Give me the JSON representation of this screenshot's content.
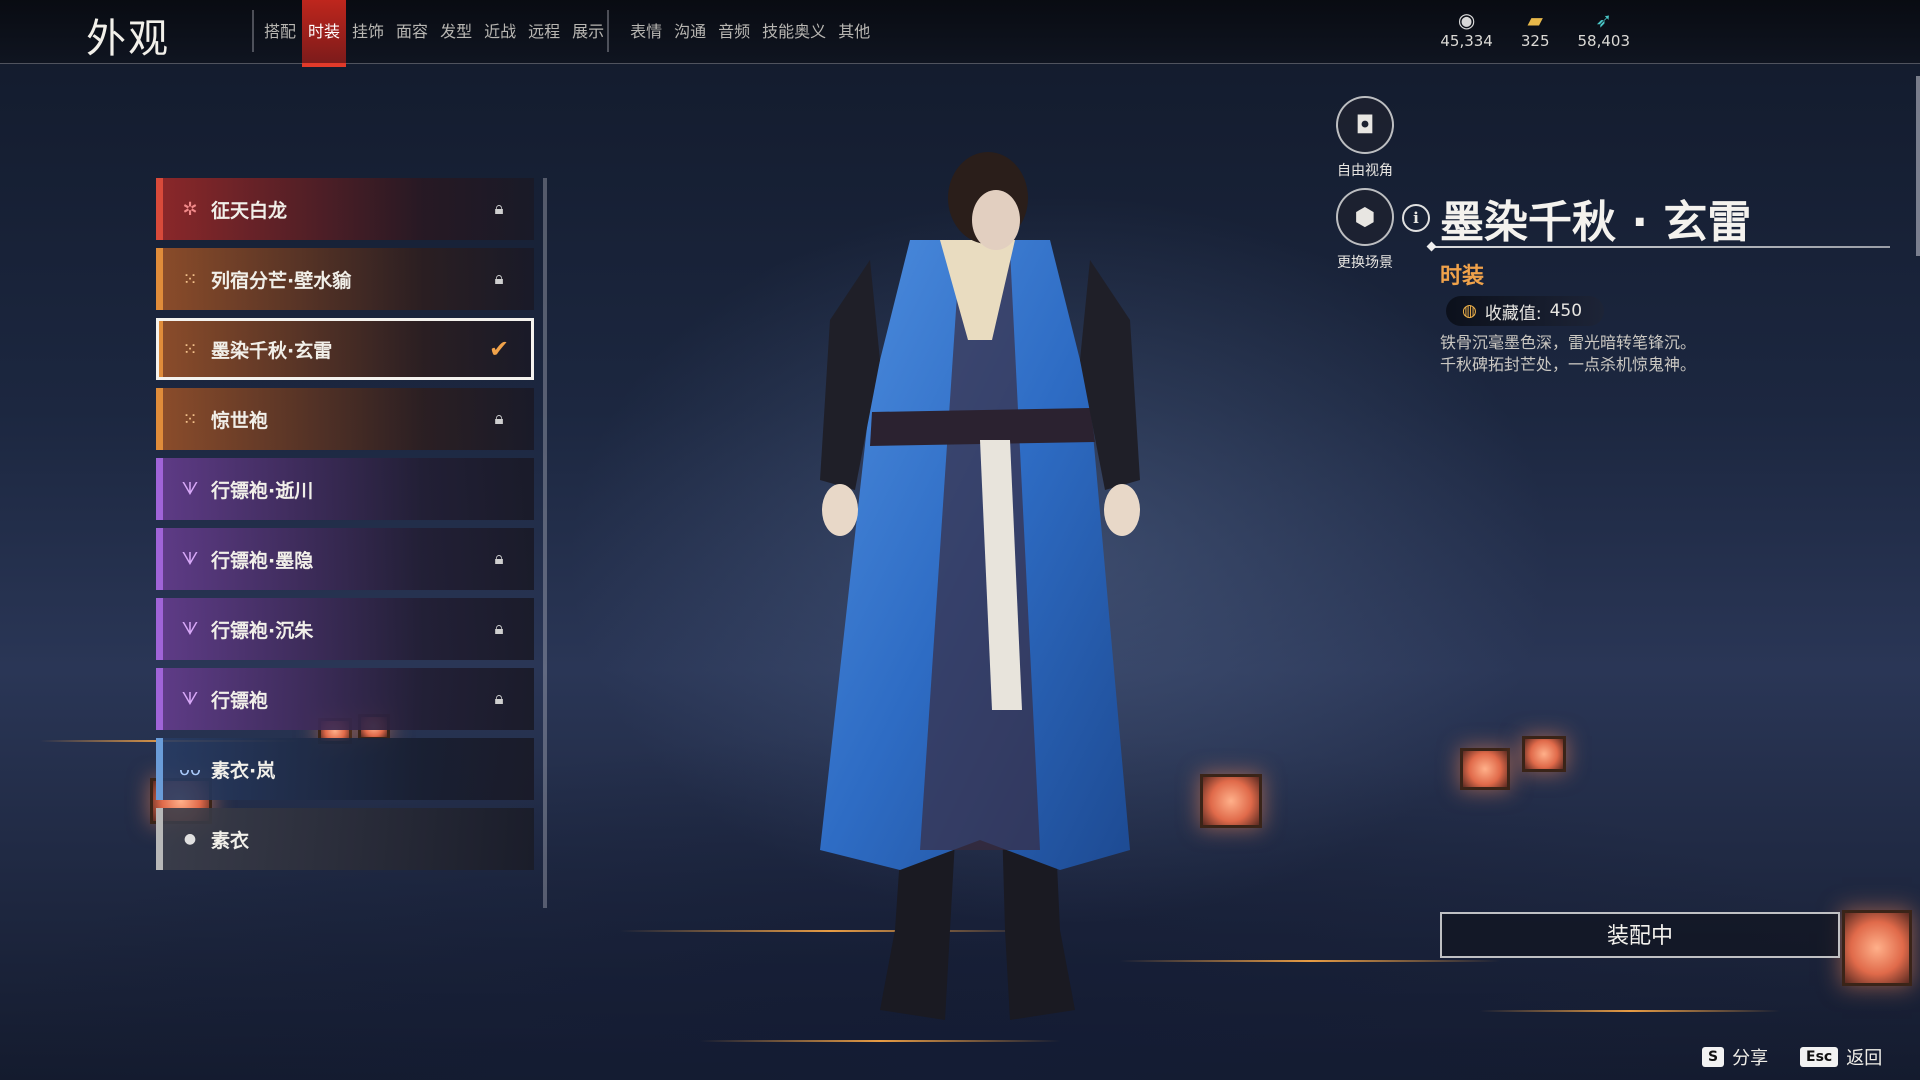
{
  "header": {
    "title": "外观",
    "tabs": [
      {
        "label": "搭配",
        "active": false
      },
      {
        "label": "时装",
        "active": true
      },
      {
        "label": "挂饰",
        "active": false
      },
      {
        "label": "面容",
        "active": false
      },
      {
        "label": "发型",
        "active": false
      },
      {
        "label": "近战",
        "active": false
      },
      {
        "label": "远程",
        "active": false
      },
      {
        "label": "展示",
        "active": false
      },
      {
        "label": "表情",
        "active": false
      },
      {
        "label": "沟通",
        "active": false
      },
      {
        "label": "音频",
        "active": false
      },
      {
        "label": "技能奥义",
        "active": false
      },
      {
        "label": "其他",
        "active": false
      }
    ],
    "currencies": [
      {
        "icon": "coin-stack-icon",
        "value": "45,334"
      },
      {
        "icon": "ticket-icon",
        "value": "325"
      },
      {
        "icon": "feather-icon",
        "value": "58,403"
      }
    ]
  },
  "outfits": [
    {
      "name": "征天白龙",
      "rarity": "red",
      "badge": "star-badge-icon",
      "status": "locked"
    },
    {
      "name": "列宿分芒·壁水貐",
      "rarity": "orange",
      "badge": "cross-badge-icon",
      "status": "locked"
    },
    {
      "name": "墨染千秋·玄雷",
      "rarity": "orange",
      "badge": "cross-badge-icon",
      "status": "equipped"
    },
    {
      "name": "惊世袍",
      "rarity": "orange",
      "badge": "cross-badge-icon",
      "status": "locked"
    },
    {
      "name": "行镖袍·逝川",
      "rarity": "purple",
      "badge": "fork-badge-icon",
      "status": "unlocked"
    },
    {
      "name": "行镖袍·墨隐",
      "rarity": "purple",
      "badge": "fork-badge-icon",
      "status": "locked"
    },
    {
      "name": "行镖袍·沉朱",
      "rarity": "purple",
      "badge": "fork-badge-icon",
      "status": "locked"
    },
    {
      "name": "行镖袍",
      "rarity": "purple",
      "badge": "fork-badge-icon",
      "status": "locked"
    },
    {
      "name": "素衣·岚",
      "rarity": "blue",
      "badge": "wing-badge-icon",
      "status": "unlocked"
    },
    {
      "name": "素衣",
      "rarity": "white",
      "badge": "drop-badge-icon",
      "status": "unlocked"
    }
  ],
  "tools": {
    "free_view": "自由视角",
    "change_scene": "更换场景"
  },
  "detail": {
    "title": "墨染千秋 · 玄雷",
    "category": "时装",
    "collect_label": "收藏值:",
    "collect_value": "450",
    "desc_line1": "铁骨沉毫墨色深，雷光暗转笔锋沉。",
    "desc_line2": "千秋碑拓封芒处，一点杀机惊鬼神。",
    "equip_button": "装配中"
  },
  "hints": {
    "share_key": "S",
    "share_label": "分享",
    "back_key": "Esc",
    "back_label": "返回"
  },
  "colors": {
    "accent_red": "#e23a2a",
    "gold": "#f0a24a"
  }
}
